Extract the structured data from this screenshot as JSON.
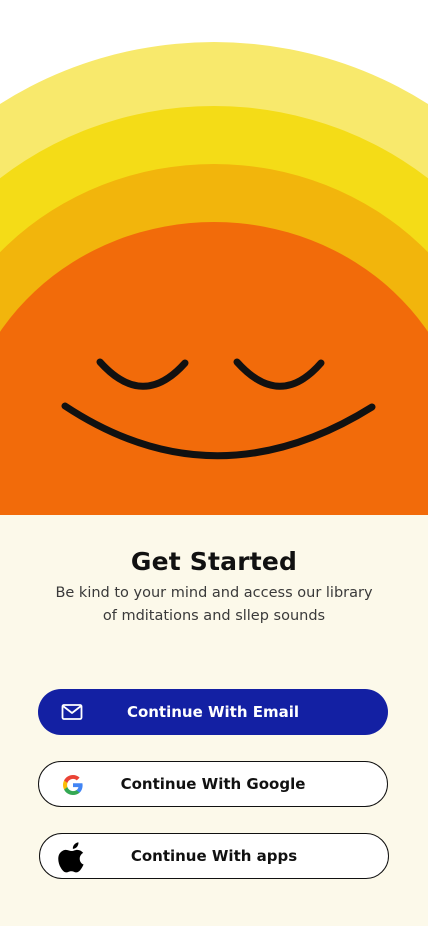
{
  "onboarding": {
    "title": "Get Started",
    "subtitle_line1": "Be kind to your mind and access our library",
    "subtitle_line2": "of mditations and sllep sounds"
  },
  "buttons": {
    "email_label": "Continue With Email",
    "google_label": "Continue With Google",
    "apple_label": "Continue With apps"
  },
  "icons": {
    "email": "mail-icon",
    "google": "google-icon",
    "apple": "apple-icon"
  },
  "colors": {
    "sun_orange": "#f26b0a",
    "ring_inner": "#f2b50c",
    "ring_middle": "#f4dc17",
    "ring_outer": "#f8e96c",
    "primary_button": "#1320a3",
    "panel_background": "#fcf9ea"
  }
}
